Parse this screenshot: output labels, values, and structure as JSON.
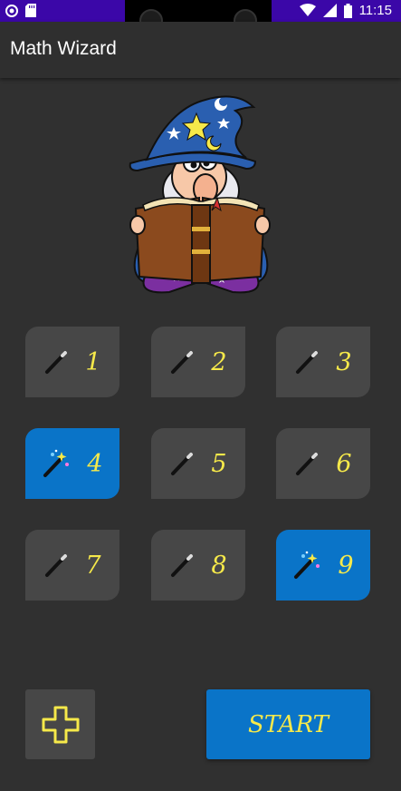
{
  "status_bar": {
    "time": "11:15"
  },
  "app_bar": {
    "title": "Math Wizard"
  },
  "tiles": [
    {
      "label": "1",
      "active": false,
      "icon": "wand-icon"
    },
    {
      "label": "2",
      "active": false,
      "icon": "wand-icon"
    },
    {
      "label": "3",
      "active": false,
      "icon": "wand-icon"
    },
    {
      "label": "4",
      "active": true,
      "icon": "magic-wand-sparkle-icon"
    },
    {
      "label": "5",
      "active": false,
      "icon": "wand-icon"
    },
    {
      "label": "6",
      "active": false,
      "icon": "wand-icon"
    },
    {
      "label": "7",
      "active": false,
      "icon": "wand-icon"
    },
    {
      "label": "8",
      "active": false,
      "icon": "wand-icon"
    },
    {
      "label": "9",
      "active": true,
      "icon": "magic-wand-sparkle-icon"
    }
  ],
  "actions": {
    "start_label": "START",
    "add_icon": "plus-icon"
  },
  "colors": {
    "accent": "#0a74c8",
    "label": "#f6e94a",
    "tile": "#474747",
    "background": "#303030",
    "status_bar": "#3b07a8"
  }
}
